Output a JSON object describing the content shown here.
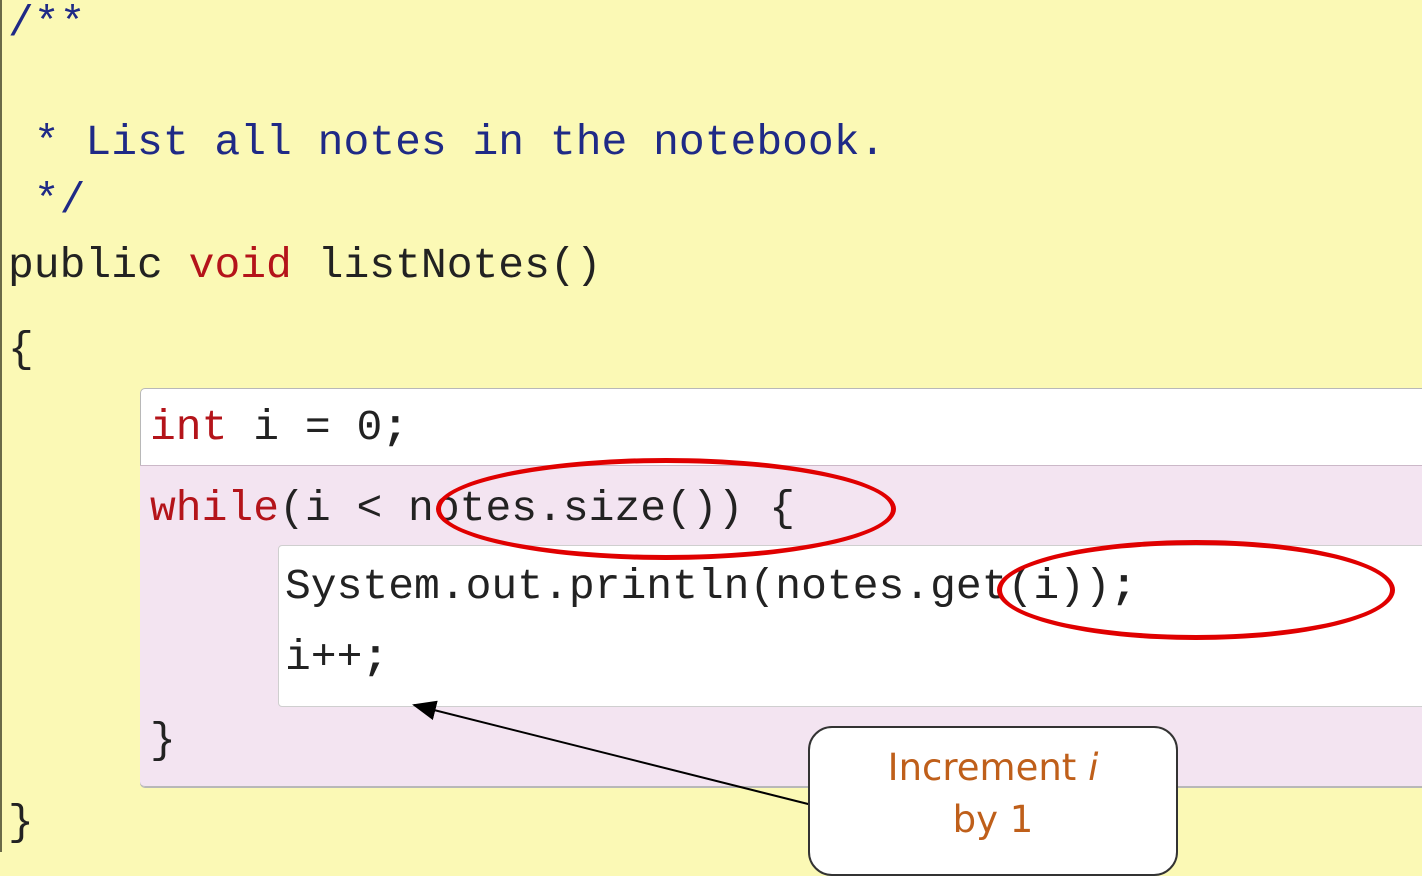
{
  "code": {
    "comment_open": "/**",
    "comment_text": " * List all notes in the notebook.",
    "comment_close": " */",
    "sig_kw1": "public",
    "sig_kw2": "void",
    "sig_rest": "listNotes()",
    "brace_open": "{",
    "int_kw": "int",
    "int_rest": " i = 0",
    "int_semi": ";",
    "while_kw": "while",
    "while_rest": "(i < notes.size()) {",
    "println_text": "System.out.println(notes.get(i))",
    "println_semi": ";",
    "incr_text": "i++",
    "incr_semi": ";",
    "while_close": "}",
    "method_close": "}"
  },
  "callout": {
    "line1_prefix": "Increment ",
    "line1_var": "i",
    "line2": "by 1"
  },
  "colors": {
    "background": "#fbf9b5",
    "comment": "#1f2a86",
    "keyword": "#b4141a",
    "highlight_ellipse": "#e00000",
    "callout_text": "#bf5f1a"
  }
}
